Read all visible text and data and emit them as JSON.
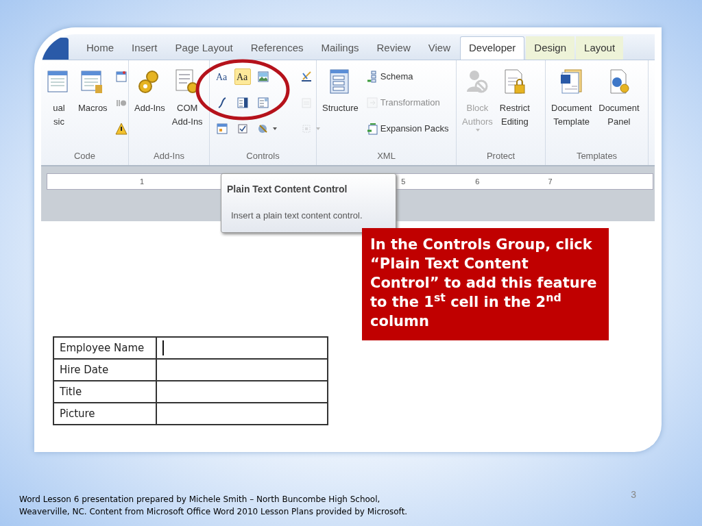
{
  "ribbon": {
    "tabs": [
      {
        "label": "Home",
        "selected": false,
        "contextual": false
      },
      {
        "label": "Insert",
        "selected": false,
        "contextual": false
      },
      {
        "label": "Page Layout",
        "selected": false,
        "contextual": false
      },
      {
        "label": "References",
        "selected": false,
        "contextual": false
      },
      {
        "label": "Mailings",
        "selected": false,
        "contextual": false
      },
      {
        "label": "Review",
        "selected": false,
        "contextual": false
      },
      {
        "label": "View",
        "selected": false,
        "contextual": false
      },
      {
        "label": "Developer",
        "selected": true,
        "contextual": false
      },
      {
        "label": "Design",
        "selected": false,
        "contextual": true
      },
      {
        "label": "Layout",
        "selected": false,
        "contextual": true
      }
    ],
    "groups": [
      {
        "label": "Code",
        "columns": [
          {
            "kind": "large",
            "label": "ual\nsic",
            "disabled": false
          },
          {
            "kind": "large",
            "label": "Macros",
            "disabled": false
          },
          {
            "kind": "stack",
            "items": [
              {
                "selected": false,
                "disabled": false
              },
              {
                "selected": false,
                "disabled": false
              },
              {
                "selected": false,
                "disabled": false
              }
            ]
          }
        ]
      },
      {
        "label": "Add-Ins",
        "columns": [
          {
            "kind": "large",
            "label": "Add-Ins",
            "disabled": false
          },
          {
            "kind": "large",
            "label": "COM\nAdd-Ins",
            "disabled": false
          }
        ]
      },
      {
        "label": "Controls",
        "columns": [
          {
            "kind": "stack",
            "items": [
              {
                "glyph": "Aa",
                "selected": false,
                "disabled": false
              },
              {
                "selected": false,
                "disabled": false
              },
              {
                "selected": false,
                "disabled": false
              }
            ]
          },
          {
            "kind": "stack",
            "items": [
              {
                "glyph": "Aa",
                "selected": true,
                "disabled": false
              },
              {
                "selected": false,
                "disabled": false
              },
              {
                "selected": false,
                "disabled": false
              }
            ]
          },
          {
            "kind": "stack",
            "items": [
              {
                "selected": false,
                "disabled": false
              },
              {
                "selected": false,
                "disabled": false
              },
              {
                "selected": false,
                "disabled": false,
                "dropdown": true
              }
            ]
          },
          {
            "kind": "stack",
            "items": [
              {
                "selected": false,
                "disabled": false
              },
              {
                "selected": false,
                "disabled": true
              },
              {
                "selected": false,
                "disabled": true,
                "dropdown": true
              }
            ]
          }
        ]
      },
      {
        "label": "XML",
        "columns": [
          {
            "kind": "large",
            "label": "Structure",
            "disabled": false
          },
          {
            "kind": "stack",
            "items": [
              {
                "label": "Schema",
                "selected": false,
                "disabled": false
              },
              {
                "label": "Transformation",
                "selected": false,
                "disabled": true
              },
              {
                "label": "Expansion Packs",
                "selected": false,
                "disabled": false
              }
            ]
          }
        ]
      },
      {
        "label": "Protect",
        "columns": [
          {
            "kind": "large",
            "label": "Block\nAuthors",
            "disabled": true,
            "dropdown": true
          },
          {
            "kind": "large",
            "label": "Restrict\nEditing",
            "disabled": false
          }
        ]
      },
      {
        "label": "Templates",
        "columns": [
          {
            "kind": "large",
            "label": "Document\nTemplate",
            "disabled": false
          },
          {
            "kind": "large",
            "label": "Document\nPanel",
            "disabled": false
          }
        ]
      }
    ]
  },
  "ruler": {
    "numbers": [
      "1",
      "5",
      "6",
      "7"
    ]
  },
  "tooltip": {
    "title": "Plain Text Content Control",
    "description": "Insert a plain text content control."
  },
  "table": {
    "rows": [
      {
        "label": "Employee Name",
        "cursor": true
      },
      {
        "label": "Hire Date",
        "cursor": false
      },
      {
        "label": "Title",
        "cursor": false
      },
      {
        "label": "Picture",
        "cursor": false
      }
    ]
  },
  "callout": "In the Controls Group, click “Plain Text Content Control” to add this feature to the 1$^{st}$ cell in the 2$^{nd}$ column",
  "footer": "Word Lesson 6 presentation prepared by Michele Smith – North Buncombe High School, Weaverville, NC. Content from Microsoft Office Word 2010 Lesson Plans provided by Microsoft.",
  "page_number": "3"
}
